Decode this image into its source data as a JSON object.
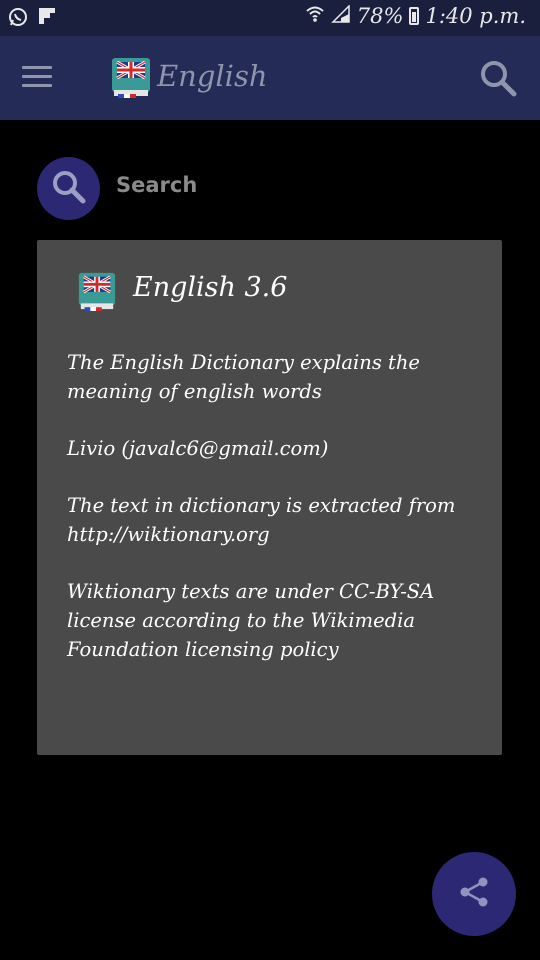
{
  "status_bar": {
    "battery": "78%",
    "time": "1:40 p.m."
  },
  "app_bar": {
    "title": "English"
  },
  "search": {
    "label": "Search"
  },
  "about": {
    "title": "English 3.6",
    "paragraphs": [
      "The English Dictionary explains the meaning of english words",
      "Livio (javalc6@gmail.com)",
      "The text in dictionary is extracted from http://wiktionary.org",
      "Wiktionary texts are under CC-BY-SA license according to the Wikimedia Foundation licensing policy"
    ]
  },
  "colors": {
    "app_bar": "#242b57",
    "accent": "#2d2873",
    "card": "#4a4a4a"
  }
}
